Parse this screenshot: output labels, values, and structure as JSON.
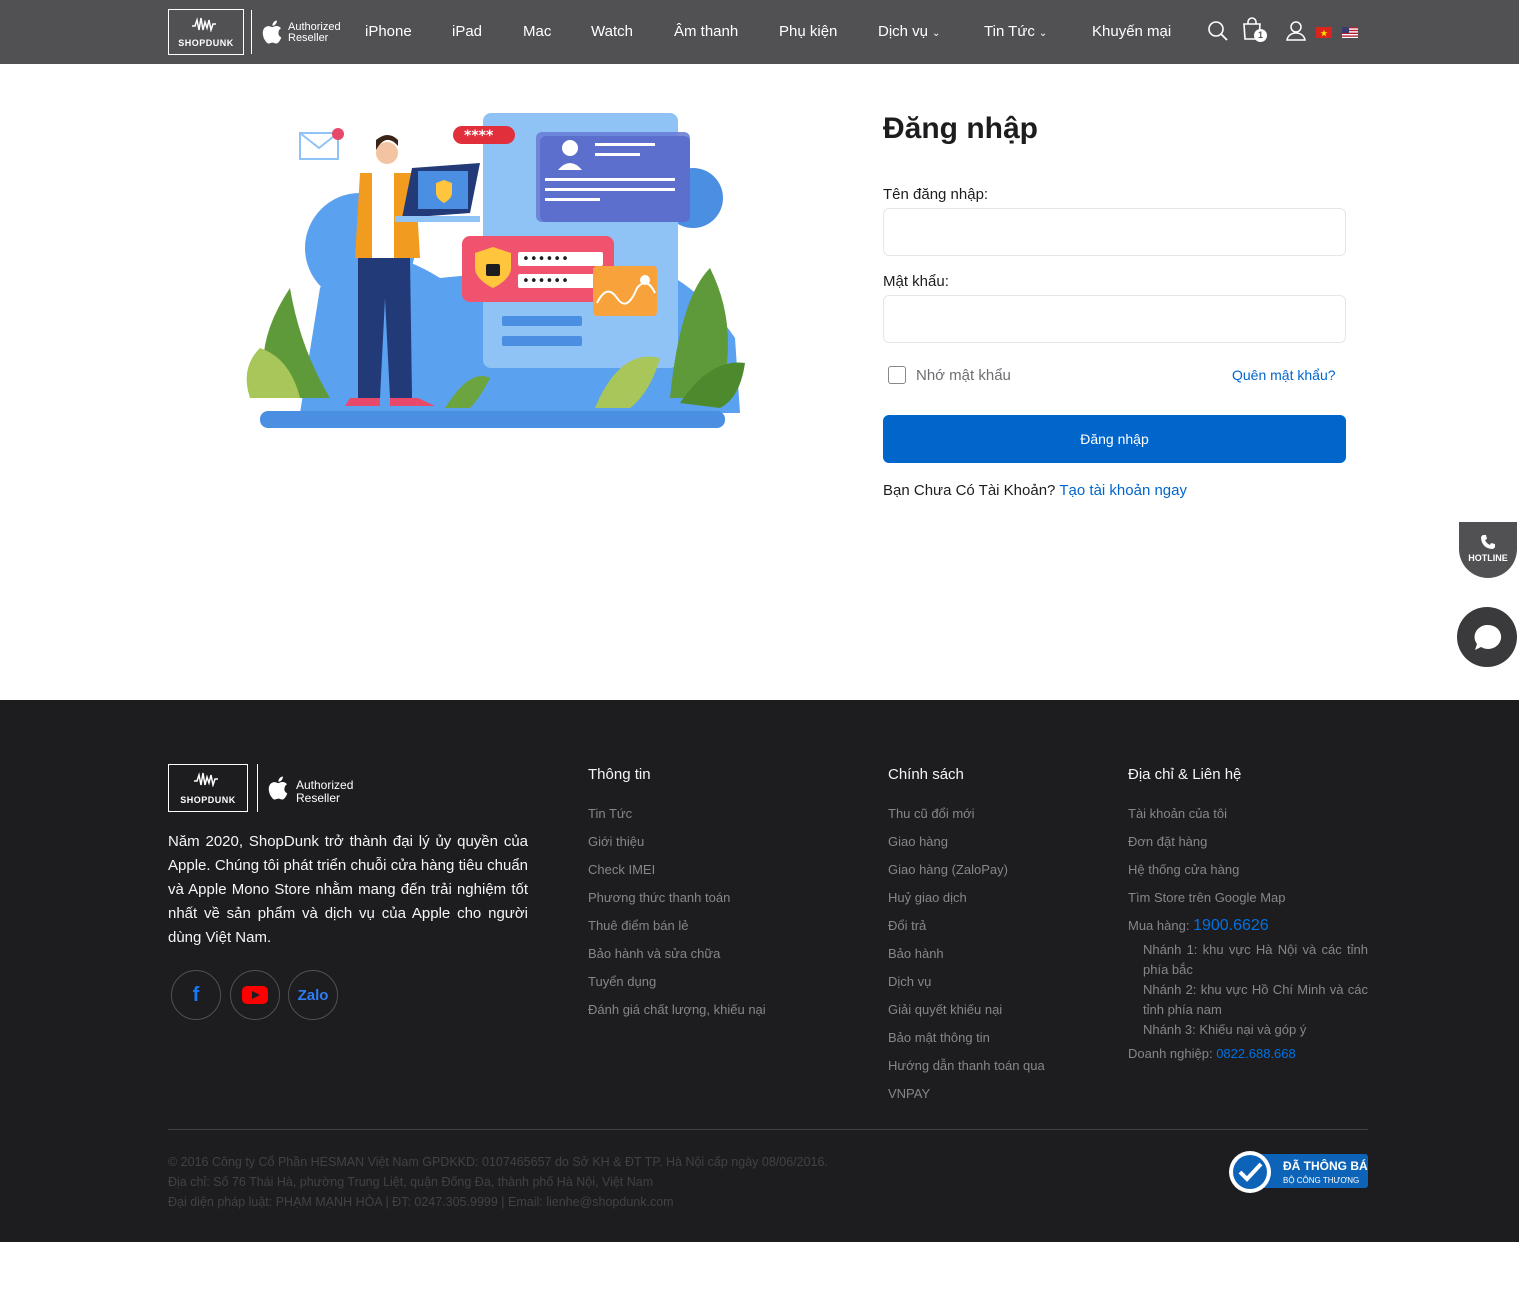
{
  "header": {
    "logo_text": "SHOPDUNK",
    "auth_line1": "Authorized",
    "auth_line2": "Reseller",
    "nav": [
      {
        "label": "iPhone"
      },
      {
        "label": "iPad"
      },
      {
        "label": "Mac"
      },
      {
        "label": "Watch"
      },
      {
        "label": "Âm thanh"
      },
      {
        "label": "Phụ kiện"
      },
      {
        "label": "Dịch vụ",
        "has_dropdown": true
      },
      {
        "label": "Tin Tức",
        "has_dropdown": true
      },
      {
        "label": "Khuyến mại"
      }
    ],
    "cart_count": "1",
    "icons": [
      "search-icon",
      "cart-icon",
      "user-icon",
      "flag-vn-icon",
      "flag-us-icon"
    ]
  },
  "illustration": {
    "password_bubble": "****",
    "password_dots": "••••••"
  },
  "login": {
    "title": "Đăng nhập",
    "username_label": "Tên đăng nhập:",
    "username_value": "",
    "password_label": "Mật khẩu:",
    "password_value": "",
    "remember_label": "Nhớ mật khẩu",
    "remember_checked": false,
    "forgot_label": "Quên mật khẩu?",
    "submit_label": "Đăng nhập",
    "no_account_text": "Bạn Chưa Có Tài Khoản?",
    "register_link": "Tạo tài khoản ngay"
  },
  "floating": {
    "hotline_label": "HOTLINE"
  },
  "footer": {
    "logo_text": "SHOPDUNK",
    "auth_line1": "Authorized",
    "auth_line2": "Reseller",
    "about": "Năm 2020, ShopDunk trở thành đại lý ủy quyền của Apple. Chúng tôi phát triển chuỗi cửa hàng tiêu chuẩn và Apple Mono Store nhằm mang đến trải nghiệm tốt nhất về sản phẩm và dịch vụ của Apple cho người dùng Việt Nam.",
    "social": [
      {
        "icon": "facebook-icon",
        "label": "f"
      },
      {
        "icon": "youtube-icon",
        "label": ""
      },
      {
        "icon": "zalo-icon",
        "label": "Zalo"
      }
    ],
    "info": {
      "title": "Thông tin",
      "items": [
        "Tin Tức",
        "Giới thiệu",
        "Check IMEI",
        "Phương thức thanh toán",
        "Thuê điểm bán lẻ",
        "Bảo hành và sửa chữa",
        "Tuyển dụng",
        "Đánh giá chất lượng, khiếu nại"
      ]
    },
    "policy": {
      "title": "Chính sách",
      "items": [
        "Thu cũ đổi mới",
        "Giao hàng",
        "Giao hàng (ZaloPay)",
        "Huỷ giao dịch",
        "Đổi trả",
        "Bảo hành",
        "Dịch vụ",
        "Giải quyết khiếu nại",
        "Bảo mật thông tin",
        "Hướng dẫn thanh toán qua",
        "VNPAY"
      ]
    },
    "contact": {
      "title": "Địa chỉ & Liên hệ",
      "items": [
        "Tài khoản của tôi",
        "Đơn đặt hàng",
        "Hệ thống cửa hàng",
        "Tìm Store trên Google Map"
      ],
      "hotline_label": "Mua hàng:",
      "hotline_number": "1900.6626",
      "branch1": "Nhánh 1: khu vực Hà Nội và các tỉnh phía bắc",
      "branch2": "Nhánh 2: khu vực Hồ Chí Minh và các tỉnh phía nam",
      "branch3": "Nhánh 3: Khiếu nại và góp ý",
      "business_label": "Doanh nghiệp:",
      "business_number": "0822.688.668"
    },
    "copyright1": "© 2016 Công ty Cổ Phần HESMAN Việt Nam GPDKKD: 0107465657 do Sở KH & ĐT TP. Hà Nội cấp ngày 08/06/2016.",
    "copyright2": "Địa chỉ: Số 76 Thái Hà, phường Trung Liệt, quận Đống Đa, thành phố Hà Nội, Việt Nam",
    "copyright3": "Đại diện pháp luật: PHẠM MẠNH HÒA | ĐT: 0247.305.9999 | Email: lienhe@shopdunk.com",
    "badge_line1": "ĐÃ THÔNG BÁO",
    "badge_line2": "BỘ CÔNG THƯƠNG"
  },
  "colors": {
    "header_bg": "#515154",
    "footer_bg": "#1d1d1f",
    "primary": "#0066cc"
  }
}
